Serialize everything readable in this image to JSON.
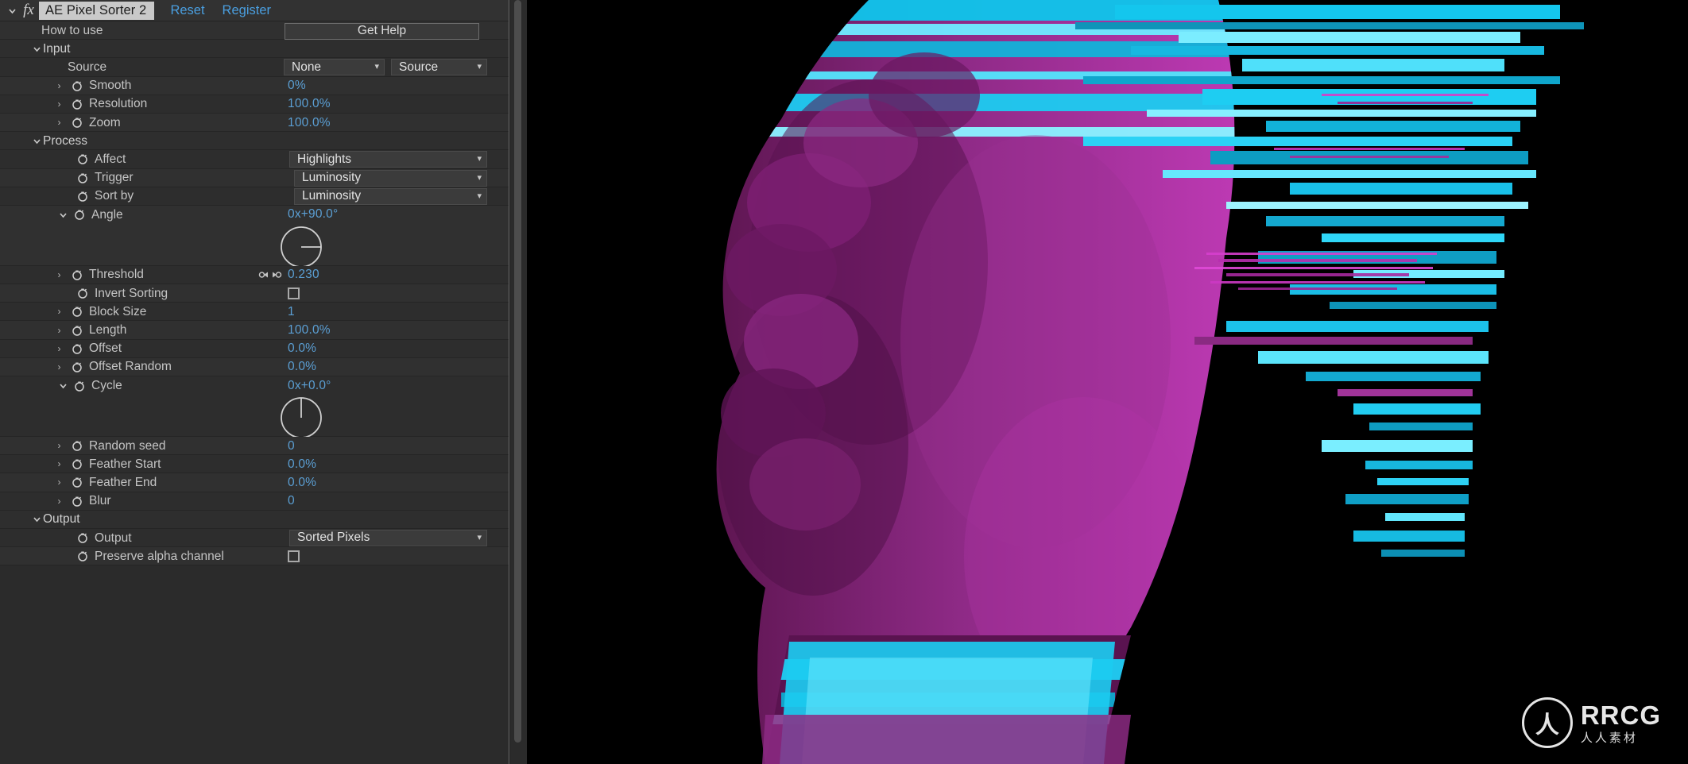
{
  "panel": {
    "effect_name": "AE Pixel Sorter 2",
    "fx_glyph": "fx",
    "links": [
      {
        "label": "Reset",
        "name": "reset-link"
      },
      {
        "label": "Register",
        "name": "register-link"
      }
    ],
    "how_to_use_label": "How to use",
    "get_help_label": "Get Help",
    "groups": {
      "input": "Input",
      "process": "Process",
      "output": "Output"
    },
    "rows": {
      "source": {
        "label": "Source",
        "value_a": "None",
        "value_b": "Source"
      },
      "smooth": {
        "label": "Smooth",
        "value": "0",
        "unit": "%"
      },
      "resolution": {
        "label": "Resolution",
        "value": "100.0",
        "unit": "%"
      },
      "zoom": {
        "label": "Zoom",
        "value": "100.0",
        "unit": "%"
      },
      "affect": {
        "label": "Affect",
        "value": "Highlights"
      },
      "trigger": {
        "label": "Trigger",
        "value": "Luminosity"
      },
      "sort_by": {
        "label": "Sort by",
        "value": "Luminosity"
      },
      "angle": {
        "label": "Angle",
        "value": "0x+90.0",
        "unit": "°",
        "dial_deg": 90
      },
      "threshold": {
        "label": "Threshold",
        "value": "0.230"
      },
      "invert_sorting": {
        "label": "Invert Sorting",
        "checked": false
      },
      "block_size": {
        "label": "Block Size",
        "value": "1"
      },
      "length": {
        "label": "Length",
        "value": "100.0",
        "unit": "%"
      },
      "offset": {
        "label": "Offset",
        "value": "0.0",
        "unit": "%"
      },
      "offset_random": {
        "label": "Offset Random",
        "value": "0.0",
        "unit": "%"
      },
      "cycle": {
        "label": "Cycle",
        "value": "0x+0.0",
        "unit": "°",
        "dial_deg": 0
      },
      "random_seed": {
        "label": "Random seed",
        "value": "0"
      },
      "feather_start": {
        "label": "Feather Start",
        "value": "0.0",
        "unit": "%"
      },
      "feather_end": {
        "label": "Feather End",
        "value": "0.0",
        "unit": "%"
      },
      "blur": {
        "label": "Blur",
        "value": "0"
      },
      "output": {
        "label": "Output",
        "value": "Sorted Pixels"
      },
      "preserve_alpha": {
        "label": "Preserve alpha channel",
        "checked": false
      }
    }
  },
  "viewer": {
    "subject": "glitched classical bust (pixel-sorted)",
    "background_color": "#000000",
    "accent_cyan": "#19d6f5",
    "accent_magenta": "#b02fa8",
    "accent_purple": "#7c2470"
  },
  "watermark": {
    "badge": "人",
    "main": "RRCG",
    "sub": "人人素材"
  }
}
